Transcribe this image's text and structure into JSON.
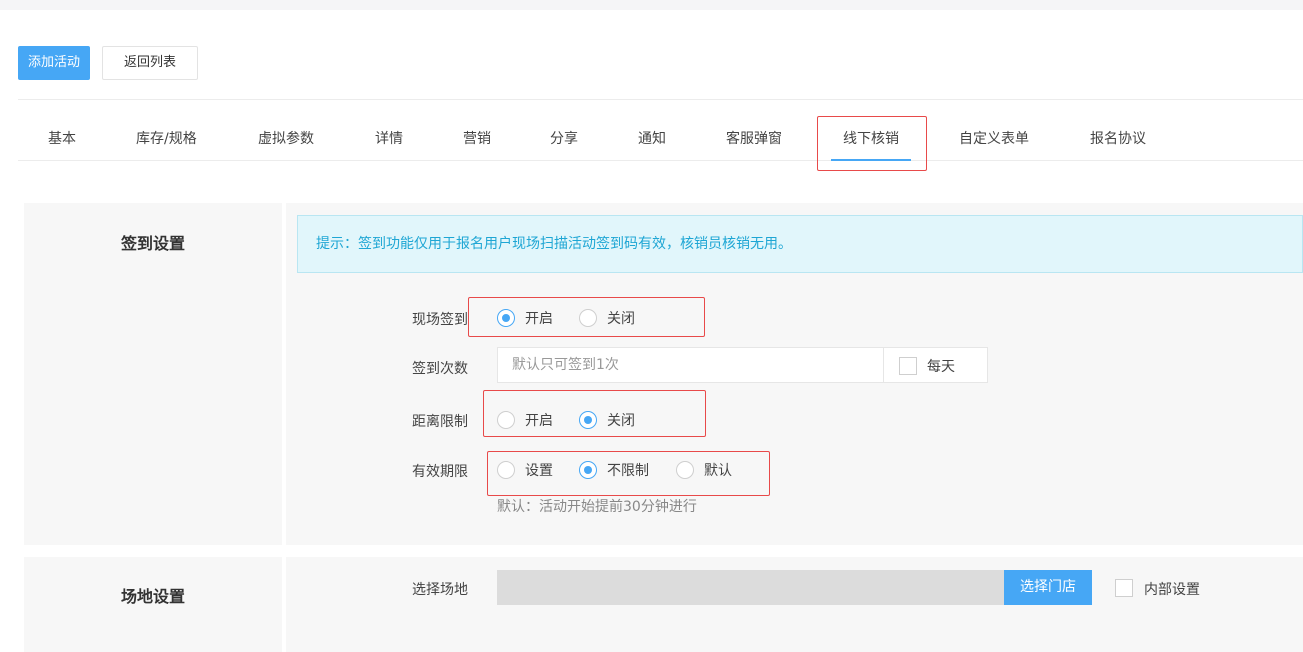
{
  "toolbar": {
    "add_label": "添加活动",
    "back_label": "返回列表"
  },
  "tabs": [
    {
      "label": "基本"
    },
    {
      "label": "库存/规格"
    },
    {
      "label": "虚拟参数"
    },
    {
      "label": "详情"
    },
    {
      "label": "营销"
    },
    {
      "label": "分享"
    },
    {
      "label": "通知"
    },
    {
      "label": "客服弹窗"
    },
    {
      "label": "线下核销"
    },
    {
      "label": "自定义表单"
    },
    {
      "label": "报名协议"
    }
  ],
  "active_tab": "线下核销",
  "checkin": {
    "section_title": "签到设置",
    "tip": "提示：签到功能仅用于报名用户现场扫描活动签到码有效，核销员核销无用。",
    "onsite": {
      "label": "现场签到",
      "options": [
        "开启",
        "关闭"
      ],
      "selected": "开启"
    },
    "count": {
      "label": "签到次数",
      "placeholder": "默认只可签到1次",
      "daily_label": "每天",
      "daily_checked": false
    },
    "distance": {
      "label": "距离限制",
      "options": [
        "开启",
        "关闭"
      ],
      "selected": "关闭"
    },
    "validity": {
      "label": "有效期限",
      "options": [
        "设置",
        "不限制",
        "默认"
      ],
      "selected": "不限制",
      "hint": "默认：活动开始提前30分钟进行"
    }
  },
  "venue": {
    "section_title": "场地设置",
    "label": "选择场地",
    "value": "",
    "select_button": "选择门店",
    "internal_label": "内部设置",
    "internal_checked": false
  },
  "colors": {
    "accent": "#46a7f5",
    "highlight": "#e84a4a",
    "tip_text": "#1ea6d4",
    "tip_bg": "#e1f6fb"
  }
}
